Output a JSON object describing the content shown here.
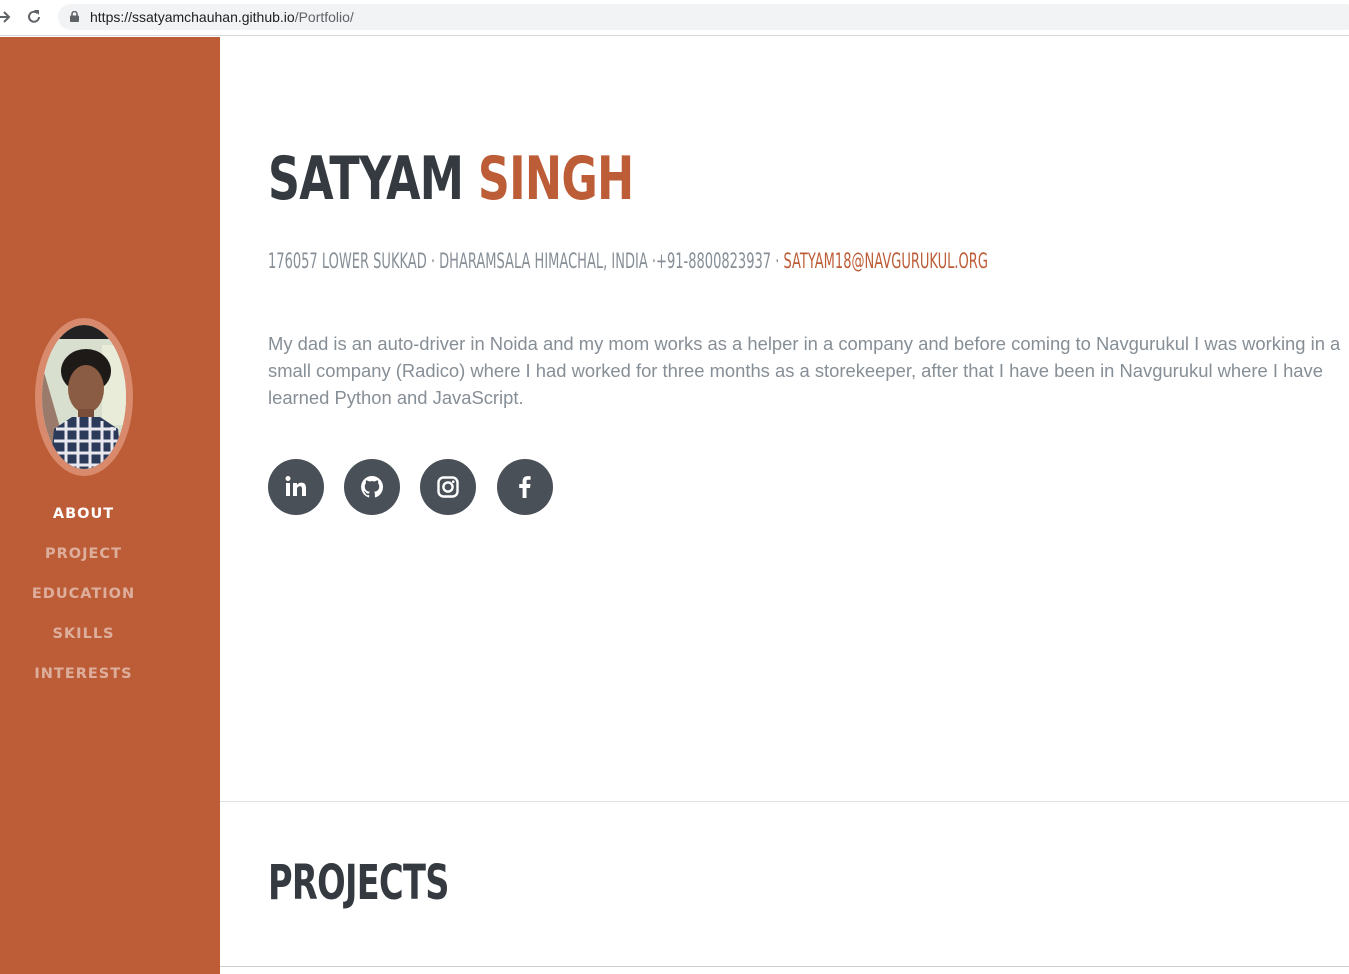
{
  "browser": {
    "url_host": "https://ssatyamchauhan.github.io",
    "url_path": "/Portfolio/"
  },
  "colors": {
    "primary": "#bd5d38",
    "dark": "#343a40",
    "muted": "#868e96",
    "social_bg": "#495057"
  },
  "sidebar": {
    "nav": [
      {
        "label": "ABOUT",
        "active": true
      },
      {
        "label": "PROJECT",
        "active": false
      },
      {
        "label": "EDUCATION",
        "active": false
      },
      {
        "label": "SKILLS",
        "active": false
      },
      {
        "label": "INTERESTS",
        "active": false
      }
    ]
  },
  "about": {
    "first_name": "SATYAM",
    "last_name": "SINGH",
    "address": "176057 LOWER SUKKAD · DHARAMSALA HIMACHAL, INDIA ·+91-8800823937 ·",
    "email": "SATYAM18@NAVGURUKUL.ORG",
    "bio": "My dad is an auto-driver in Noida and my mom works as a helper in a company and before coming to Navgurukul I was working in a small company (Radico) where I had worked for three months as a storekeeper, after that I have been in Navgurukul where I have learned Python and JavaScript.",
    "socials": [
      "linkedin-icon",
      "github-icon",
      "instagram-icon",
      "facebook-icon"
    ]
  },
  "projects": {
    "title": "PROJECTS"
  }
}
